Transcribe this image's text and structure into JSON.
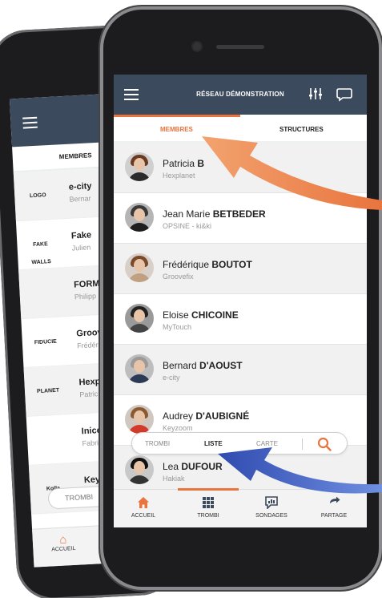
{
  "colors": {
    "accent": "#e9743e",
    "topbar": "#3c4a5e",
    "arrow_orange": "#e9743e",
    "arrow_blue": "#2f4bb0"
  },
  "back_phone": {
    "tab_label": "MEMBRES",
    "rows": [
      {
        "logo": "LOGO",
        "name": "e-city",
        "sub": "Bernar"
      },
      {
        "logo": "FAKE WALLS",
        "name": "Fake",
        "sub": "Julien"
      },
      {
        "logo": "",
        "name": "FORM",
        "sub": "Philipp"
      },
      {
        "logo": "FIDUCIE",
        "name": "Groov",
        "sub": "Frédér"
      },
      {
        "logo": "PLANET",
        "name": "Hexp",
        "sub": "Patric"
      },
      {
        "logo": "",
        "name": "Inice",
        "sub": "Fabric"
      },
      {
        "logo": "Kolla",
        "name": "Keyzo",
        "sub": ""
      }
    ],
    "trombi_label": "TROMBI",
    "accueil_label": "ACCUEIL"
  },
  "topbar": {
    "title": "RÉSEAU DÉMONSTRATION",
    "menu_icon": "hamburger-icon",
    "filter_icon": "sliders-icon",
    "chat_icon": "chat-icon"
  },
  "tabs": {
    "membres": "MEMBRES",
    "structures": "STRUCTURES"
  },
  "members": [
    {
      "first": "Patricia ",
      "last": "B",
      "org": "Hexplanet",
      "hair": "#6b3a22",
      "body": "#2a2a2a",
      "bg": "#cfcfcf"
    },
    {
      "first": "Jean Marie ",
      "last": "BETBEDER",
      "org": "OPSINE - ki&ki",
      "hair": "#3a3a3a",
      "body": "#1e1e1e",
      "bg": "#b5b5b5"
    },
    {
      "first": "Frédérique ",
      "last": "BOUTOT",
      "org": "Groovefix",
      "hair": "#7a4a2a",
      "body": "#c0a080",
      "bg": "#d8d0c8"
    },
    {
      "first": "Eloise ",
      "last": "CHICOINE",
      "org": "MyTouch",
      "hair": "#222222",
      "body": "#444444",
      "bg": "#9a9a9a"
    },
    {
      "first": "Bernard ",
      "last": "D'AOUST",
      "org": "e-city",
      "hair": "#9a9a9a",
      "body": "#2b3a55",
      "bg": "#bdbdbd"
    },
    {
      "first": "Audrey ",
      "last": "D'AUBIGNÉ",
      "org": "Keyzoom",
      "hair": "#8a5a30",
      "body": "#d33a2a",
      "bg": "#d0c8c0"
    },
    {
      "first": "Lea ",
      "last": "DUFOUR",
      "org": "Hakiak",
      "hair": "#111111",
      "body": "#333333",
      "bg": "#c8c8c8"
    }
  ],
  "viewbar": {
    "trombi": "TROMBI",
    "liste": "LISTE",
    "carte": "CARTE",
    "search_icon": "search-icon"
  },
  "bottomnav": {
    "accueil": "ACCUEIL",
    "trombi": "TROMBI",
    "sondages": "SONDAGES",
    "partage": "PARTAGE"
  }
}
